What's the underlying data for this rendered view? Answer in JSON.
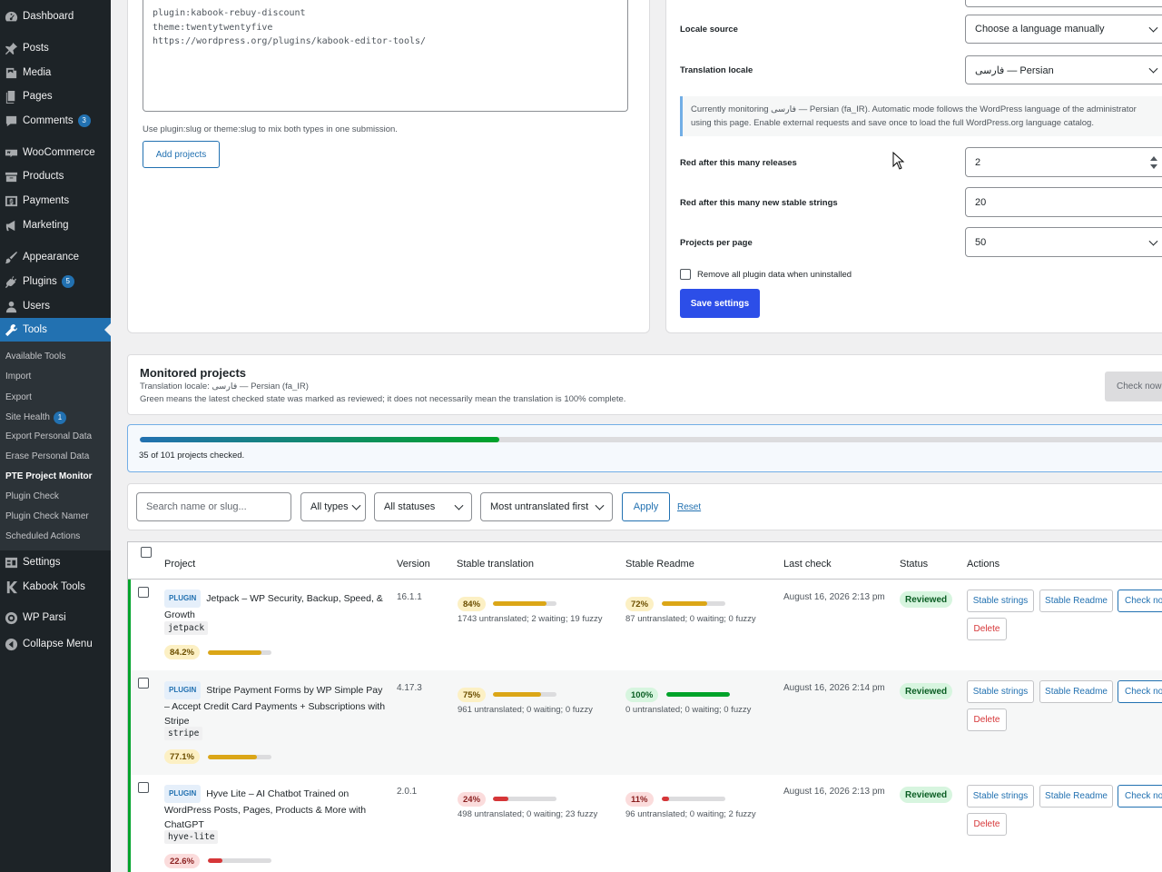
{
  "sidebar": {
    "items": [
      {
        "label": "Dashboard",
        "icon": "dashboard-icon"
      },
      {
        "label": "Posts",
        "icon": "pin-icon"
      },
      {
        "label": "Media",
        "icon": "media-icon"
      },
      {
        "label": "Pages",
        "icon": "pages-icon"
      },
      {
        "label": "Comments",
        "icon": "comment-icon",
        "badge": "3"
      },
      {
        "label": "WooCommerce",
        "icon": "woocommerce-icon"
      },
      {
        "label": "Products",
        "icon": "archive-icon"
      },
      {
        "label": "Payments",
        "icon": "dollar-icon"
      },
      {
        "label": "Marketing",
        "icon": "megaphone-icon"
      },
      {
        "label": "Appearance",
        "icon": "brush-icon"
      },
      {
        "label": "Plugins",
        "icon": "plug-icon",
        "badge": "5"
      },
      {
        "label": "Users",
        "icon": "user-icon"
      },
      {
        "label": "Tools",
        "icon": "wrench-icon"
      },
      {
        "label": "Settings",
        "icon": "settings-icon"
      },
      {
        "label": "Kabook Tools",
        "icon": "k-icon"
      },
      {
        "label": "WP Parsi",
        "icon": "wpparsi-icon"
      },
      {
        "label": "Collapse Menu",
        "icon": "collapse-icon"
      }
    ],
    "tools_sub": [
      {
        "label": "Available Tools"
      },
      {
        "label": "Import"
      },
      {
        "label": "Export"
      },
      {
        "label": "Site Health",
        "badge": "1"
      },
      {
        "label": "Export Personal Data"
      },
      {
        "label": "Erase Personal Data"
      },
      {
        "label": "PTE Project Monitor"
      },
      {
        "label": "Plugin Check"
      },
      {
        "label": "Plugin Check Namer"
      },
      {
        "label": "Scheduled Actions"
      }
    ]
  },
  "import_form": {
    "textarea_value": "plugin:kabook-rebuy-discount\ntheme:twentytwentyfive\nhttps://wordpress.org/plugins/kabook-editor-tools/",
    "help": "Use plugin:slug or theme:slug to mix both types in one submission.",
    "add_button": "Add projects"
  },
  "settings_form": {
    "locale_source_label": "Locale source",
    "locale_source_value": "Choose a language manually",
    "translation_locale_label": "Translation locale",
    "translation_locale_value": "فارسی — Persian",
    "notice_line1": "Currently monitoring فارسی — Persian (fa_IR). Automatic mode follows the WordPress language of the administrator",
    "notice_line2": "using this page. Enable external requests and save once to load the full WordPress.org language catalog.",
    "red_releases_label": "Red after this many releases",
    "red_releases_value": "2",
    "red_strings_label": "Red after this many new stable strings",
    "red_strings_value": "20",
    "per_page_label": "Projects per page",
    "per_page_value": "50",
    "remove_data_label": "Remove all plugin data when uninstalled",
    "save_button": "Save settings"
  },
  "monitored": {
    "title": "Monitored projects",
    "locale_line": "Translation locale: فارسی — Persian (fa_IR)",
    "note": "Green means the latest checked state was marked as reviewed; it does not necessarily mean the translation is 100% complete.",
    "check_now": "Check now",
    "progress_text": "35 of 101 projects checked.",
    "progress_fraction": 0.347
  },
  "filters": {
    "search_placeholder": "Search name or slug...",
    "types": "All types",
    "statuses": "All statuses",
    "sort": "Most untranslated first",
    "apply": "Apply",
    "reset": "Reset"
  },
  "table": {
    "headers": [
      "Project",
      "Version",
      "Stable translation",
      "Stable Readme",
      "Last check",
      "Status",
      "Actions"
    ],
    "rows": [
      {
        "type": "PLUGIN",
        "name": "Jetpack – WP Security, Backup, Speed, & Growth",
        "slug": "jetpack",
        "overall": "84.2%",
        "overall_value": 84.2,
        "version": "16.1.1",
        "stable_pct": "84%",
        "stable_value": 84,
        "stable_stats": "1743 untranslated; 2 waiting; 19 fuzzy",
        "readme_pct": "72%",
        "readme_value": 72,
        "readme_stats": "87 untranslated; 0 waiting; 0 fuzzy",
        "last_check": "August 16, 2026 2:13 pm",
        "status": "Reviewed",
        "actions": [
          "Stable strings",
          "Stable Readme",
          "Check now",
          "Delete"
        ]
      },
      {
        "type": "PLUGIN",
        "name": "Stripe Payment Forms by WP Simple Pay – Accept Credit Card Payments + Subscriptions with Stripe",
        "slug": "stripe",
        "overall": "77.1%",
        "overall_value": 77.1,
        "version": "4.17.3",
        "stable_pct": "75%",
        "stable_value": 75,
        "stable_stats": "961 untranslated; 0 waiting; 0 fuzzy",
        "readme_pct": "100%",
        "readme_value": 100,
        "readme_stats": "0 untranslated; 0 waiting; 0 fuzzy",
        "last_check": "August 16, 2026 2:14 pm",
        "status": "Reviewed",
        "actions": [
          "Stable strings",
          "Stable Readme",
          "Check now",
          "Delete"
        ]
      },
      {
        "type": "PLUGIN",
        "name": "Hyve Lite – AI Chatbot Trained on WordPress Posts, Pages, Products & More with ChatGPT",
        "slug": "hyve-lite",
        "overall": "22.6%",
        "overall_value": 22.6,
        "version": "2.0.1",
        "stable_pct": "24%",
        "stable_value": 24,
        "stable_stats": "498 untranslated; 0 waiting; 23 fuzzy",
        "readme_pct": "11%",
        "readme_value": 11,
        "readme_stats": "96 untranslated; 0 waiting; 2 fuzzy",
        "last_check": "August 16, 2026 2:13 pm",
        "status": "Reviewed",
        "actions": [
          "Stable strings",
          "Stable Readme",
          "Check now",
          "Delete"
        ]
      }
    ]
  },
  "colors": {
    "yellow": "#dba617",
    "green": "#00a32a",
    "red": "#d63638",
    "primary": "#2c4ee8"
  }
}
